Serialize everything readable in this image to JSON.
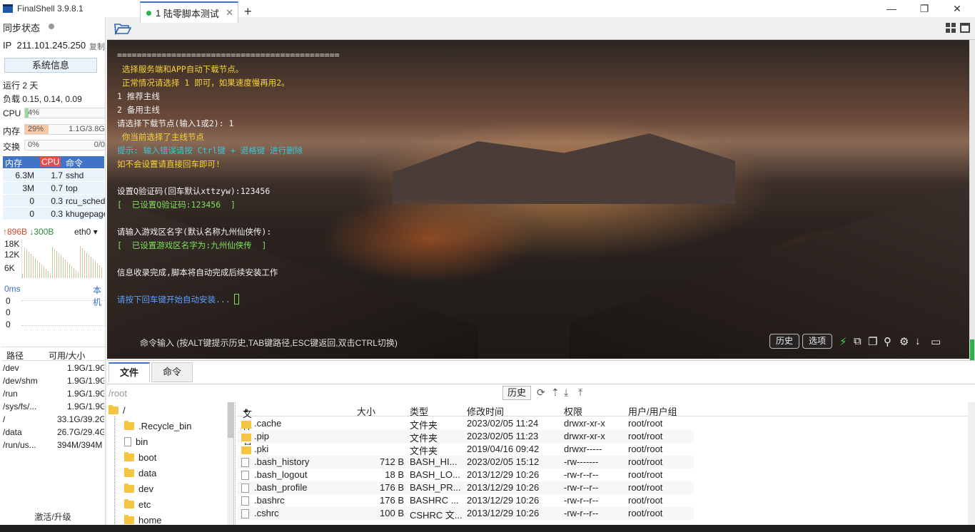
{
  "window": {
    "title": "FinalShell 3.9.8.1",
    "minimize": "—",
    "maximize": "❐",
    "close": "✕"
  },
  "left": {
    "sync_label": "同步状态",
    "ip_label": "IP",
    "ip_value": "211.101.245.250",
    "copy_label": "复制",
    "sysinfo_button": "系统信息",
    "uptime": "运行 2 天",
    "load": "负载 0.15, 0.14, 0.09",
    "cpu": {
      "label": "CPU",
      "percent": "4%",
      "fraction": 0.04
    },
    "mem": {
      "label": "内存",
      "percent": "29%",
      "value": "1.1G/3.8G",
      "fraction": 0.29
    },
    "swap": {
      "label": "交换",
      "percent": "0%",
      "value": "0/0",
      "fraction": 0
    },
    "proc_header": {
      "mem": "内存",
      "cpu": "CPU",
      "cmd": "命令"
    },
    "processes": [
      {
        "mem": "6.3M",
        "cpu": "1.7",
        "cmd": "sshd"
      },
      {
        "mem": "3M",
        "cpu": "0.7",
        "cmd": "top"
      },
      {
        "mem": "0",
        "cpu": "0.3",
        "cmd": "rcu_sched"
      },
      {
        "mem": "0",
        "cpu": "0.3",
        "cmd": "khugepaged"
      }
    ],
    "net": {
      "up": "↑896B",
      "down": "↓300B",
      "iface": "eth0",
      "ticks": [
        "18K",
        "12K",
        "6K"
      ]
    },
    "ping": {
      "label": "0ms",
      "right": "本机",
      "ticks": [
        "0",
        "0",
        "0"
      ]
    },
    "fs_header": {
      "path": "路径",
      "size": "可用/大小"
    },
    "filesystems": [
      {
        "path": "/dev",
        "size": "1.9G/1.9G"
      },
      {
        "path": "/dev/shm",
        "size": "1.9G/1.9G"
      },
      {
        "path": "/run",
        "size": "1.9G/1.9G"
      },
      {
        "path": "/sys/fs/...",
        "size": "1.9G/1.9G"
      },
      {
        "path": "/",
        "size": "33.1G/39.2G"
      },
      {
        "path": "/data",
        "size": "26.7G/29.4G"
      },
      {
        "path": "/run/us...",
        "size": "394M/394M"
      }
    ],
    "activate": "激活/升级"
  },
  "tabs": [
    {
      "index": "1",
      "label": "陆零脚本测试"
    }
  ],
  "terminal": {
    "lines": [
      {
        "text": "=============================================",
        "cls": ""
      },
      {
        "text": " 选择服务端和APP自动下载节点。",
        "cls": "t-yellow"
      },
      {
        "text": " 正常情况请选择 1 即可，如果速度慢再用2。",
        "cls": "t-yellow"
      },
      {
        "text": "1 推荐主线",
        "cls": ""
      },
      {
        "text": "2 备用主线",
        "cls": ""
      },
      {
        "text": "请选择下载节点(输入1或2): 1",
        "cls": ""
      },
      {
        "text": " 你当前选择了主线节点",
        "cls": "t-yellow"
      },
      {
        "text": "提示: 输入错误请按 Ctrl键 + 退格键 进行删除",
        "cls": "t-cyan"
      },
      {
        "text": "如不会设置请直接回车即可!",
        "cls": "t-yellow"
      },
      {
        "text": "",
        "cls": ""
      },
      {
        "text": "设置Q验证码(回车默认xttzyw):123456",
        "cls": ""
      },
      {
        "text": "[  已设置Q验证码:123456  ]",
        "cls": "t-green"
      },
      {
        "text": "",
        "cls": ""
      },
      {
        "text": "请输入游戏区名字(默认名称九州仙侠传):",
        "cls": ""
      },
      {
        "text": "[  已设置游戏区名字为:九州仙侠传  ]",
        "cls": "t-green"
      },
      {
        "text": "",
        "cls": ""
      },
      {
        "text": "信息收录完成,脚本将自动完成后续安装工作",
        "cls": ""
      },
      {
        "text": "",
        "cls": ""
      },
      {
        "text": "请按下回车键开始自动安装...",
        "cls": "t-blue"
      }
    ],
    "cmd_hint": "命令输入 (按ALT键提示历史,TAB键路径,ESC键返回,双击CTRL切换)",
    "history_button": "历史",
    "options_button": "选项"
  },
  "files": {
    "tab_files": "文件",
    "tab_commands": "命令",
    "path": "/root",
    "history_button": "历史",
    "tree": {
      "root": "/",
      "items": [
        ".Recycle_bin",
        "bin",
        "boot",
        "data",
        "dev",
        "etc",
        "home"
      ]
    },
    "headers": {
      "name": "文件名",
      "size": "大小",
      "type": "类型",
      "mtime": "修改时间",
      "perm": "权限",
      "owner": "用户/用户组"
    },
    "rows": [
      {
        "name": ".cache",
        "size": "",
        "type": "文件夹",
        "mtime": "2023/02/05 11:24",
        "perm": "drwxr-xr-x",
        "owner": "root/root",
        "folder": true
      },
      {
        "name": ".pip",
        "size": "",
        "type": "文件夹",
        "mtime": "2023/02/05 11:23",
        "perm": "drwxr-xr-x",
        "owner": "root/root",
        "folder": true
      },
      {
        "name": ".pki",
        "size": "",
        "type": "文件夹",
        "mtime": "2019/04/16 09:42",
        "perm": "drwxr-----",
        "owner": "root/root",
        "folder": true
      },
      {
        "name": ".bash_history",
        "size": "712 B",
        "type": "BASH_HI...",
        "mtime": "2023/02/05 15:12",
        "perm": "-rw-------",
        "owner": "root/root",
        "folder": false
      },
      {
        "name": ".bash_logout",
        "size": "18 B",
        "type": "BASH_LO...",
        "mtime": "2013/12/29 10:26",
        "perm": "-rw-r--r--",
        "owner": "root/root",
        "folder": false
      },
      {
        "name": ".bash_profile",
        "size": "176 B",
        "type": "BASH_PR...",
        "mtime": "2013/12/29 10:26",
        "perm": "-rw-r--r--",
        "owner": "root/root",
        "folder": false
      },
      {
        "name": ".bashrc",
        "size": "176 B",
        "type": "BASHRC ...",
        "mtime": "2013/12/29 10:26",
        "perm": "-rw-r--r--",
        "owner": "root/root",
        "folder": false
      },
      {
        "name": ".cshrc",
        "size": "100 B",
        "type": "CSHRC 文...",
        "mtime": "2013/12/29 10:26",
        "perm": "-rw-r--r--",
        "owner": "root/root",
        "folder": false
      }
    ]
  }
}
